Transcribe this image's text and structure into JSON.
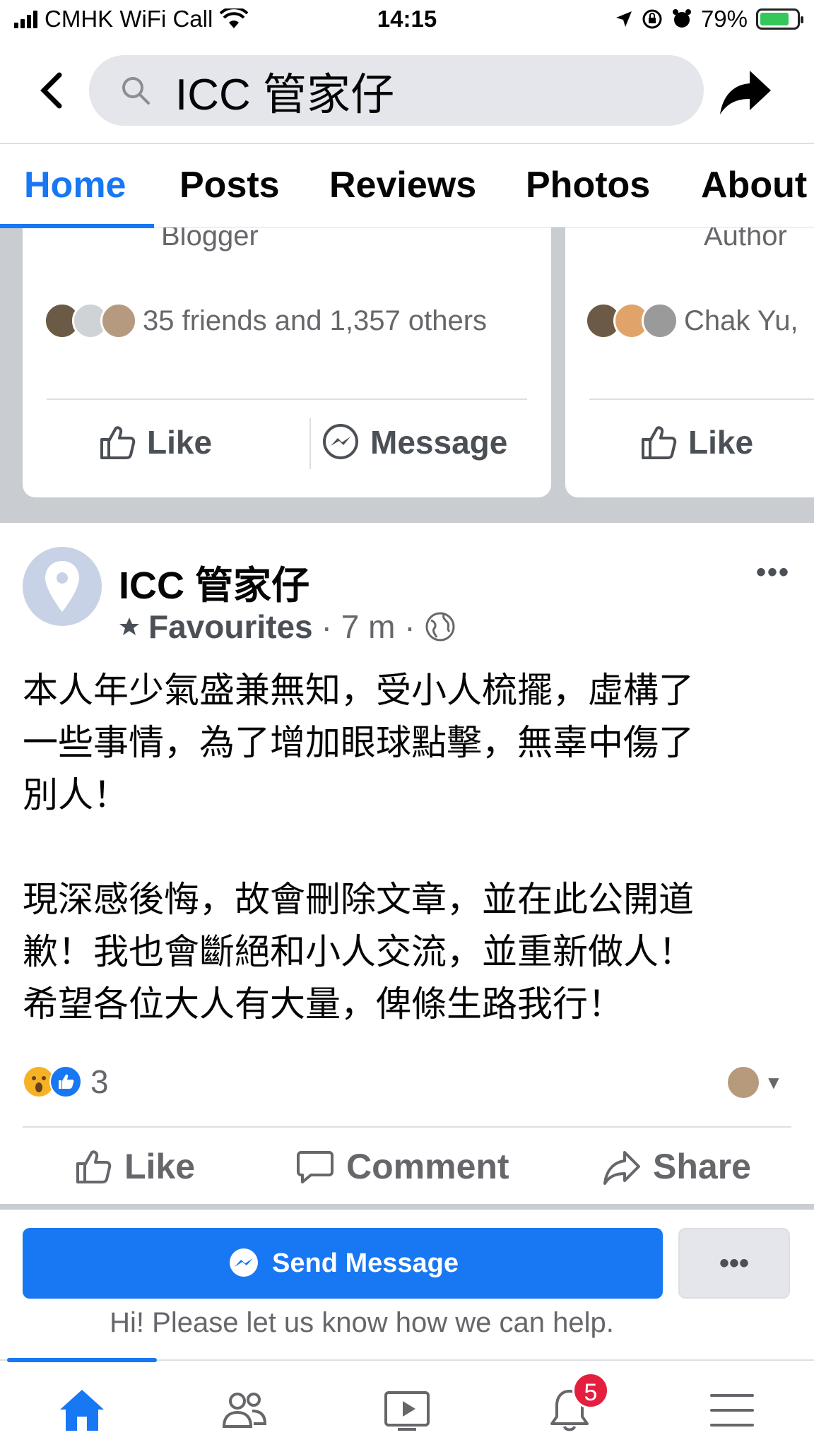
{
  "status_bar": {
    "carrier": "CMHK WiFi Call",
    "time": "14:15",
    "battery": "79%",
    "battery_level": 0.79
  },
  "search": {
    "query": "ICC 管家仔"
  },
  "tabs": [
    {
      "label": "Home",
      "active": true
    },
    {
      "label": "Posts",
      "active": false
    },
    {
      "label": "Reviews",
      "active": false
    },
    {
      "label": "Photos",
      "active": false
    },
    {
      "label": "About",
      "active": false
    }
  ],
  "suggestions": [
    {
      "subtitle": "Blogger",
      "mutual": "35 friends and 1,357 others",
      "like_label": "Like",
      "message_label": "Message"
    },
    {
      "subtitle": "Author",
      "mutual": "Chak Yu,",
      "like_label": "Like"
    }
  ],
  "post": {
    "author": "ICC 管家仔",
    "favourites": "Favourites",
    "time": "· 7 m ·",
    "lines": [
      "本人年少氣盛兼無知，受小人梳擺，虛構了",
      "一些事情，為了增加眼球點擊，無辜中傷了",
      "別人！",
      "",
      "現深感後悔，故會刪除文章，並在此公開道",
      "歉！我也會斷絕和小人交流，並重新做人！",
      "希望各位大人有大量，俾條生路我行！"
    ],
    "reaction_count": "3",
    "actions": {
      "like": "Like",
      "comment": "Comment",
      "share": "Share"
    }
  },
  "message_bar": {
    "send_label": "Send Message",
    "more_label": "•••",
    "greeting": "Hi! Please let us know how we can help."
  },
  "bottom_nav": {
    "notification_badge": "5"
  },
  "colors": {
    "accent": "#1877f2",
    "badge": "#e41e3f",
    "muted_text": "#65676b"
  }
}
